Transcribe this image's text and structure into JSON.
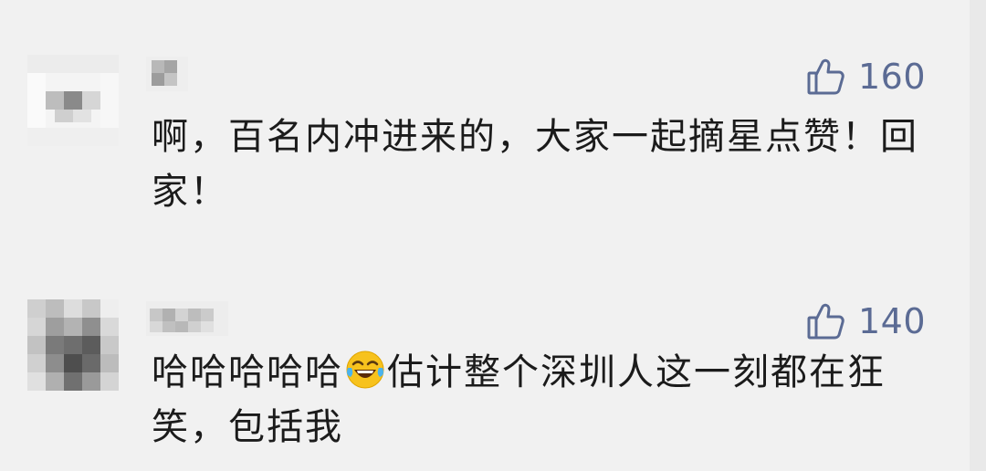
{
  "comments": [
    {
      "likes": "160",
      "text": "啊，百名内冲进来的，大家一起摘星点赞！回家！"
    },
    {
      "likes": "140",
      "text_before": "哈哈哈哈哈",
      "emoji": "tears-of-joy-emoji",
      "text_after": "估计整个深圳人这一刻都在狂笑，包括我"
    }
  ],
  "colors": {
    "background": "#f1f1f1",
    "like_color": "#5b6b94",
    "text": "#1b1b1b"
  },
  "icons": {
    "like": "thumbs-up-icon"
  }
}
